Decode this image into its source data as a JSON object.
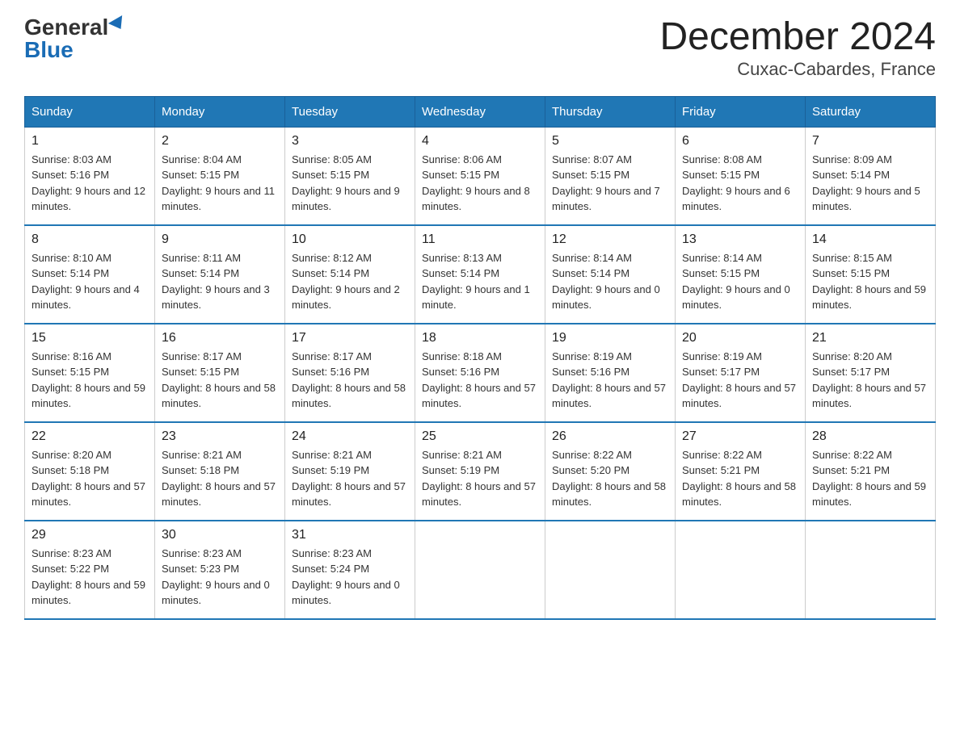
{
  "logo": {
    "general": "General",
    "blue": "Blue"
  },
  "title": "December 2024",
  "subtitle": "Cuxac-Cabardes, France",
  "weekdays": [
    "Sunday",
    "Monday",
    "Tuesday",
    "Wednesday",
    "Thursday",
    "Friday",
    "Saturday"
  ],
  "weeks": [
    [
      {
        "day": "1",
        "sunrise": "8:03 AM",
        "sunset": "5:16 PM",
        "daylight": "9 hours and 12 minutes."
      },
      {
        "day": "2",
        "sunrise": "8:04 AM",
        "sunset": "5:15 PM",
        "daylight": "9 hours and 11 minutes."
      },
      {
        "day": "3",
        "sunrise": "8:05 AM",
        "sunset": "5:15 PM",
        "daylight": "9 hours and 9 minutes."
      },
      {
        "day": "4",
        "sunrise": "8:06 AM",
        "sunset": "5:15 PM",
        "daylight": "9 hours and 8 minutes."
      },
      {
        "day": "5",
        "sunrise": "8:07 AM",
        "sunset": "5:15 PM",
        "daylight": "9 hours and 7 minutes."
      },
      {
        "day": "6",
        "sunrise": "8:08 AM",
        "sunset": "5:15 PM",
        "daylight": "9 hours and 6 minutes."
      },
      {
        "day": "7",
        "sunrise": "8:09 AM",
        "sunset": "5:14 PM",
        "daylight": "9 hours and 5 minutes."
      }
    ],
    [
      {
        "day": "8",
        "sunrise": "8:10 AM",
        "sunset": "5:14 PM",
        "daylight": "9 hours and 4 minutes."
      },
      {
        "day": "9",
        "sunrise": "8:11 AM",
        "sunset": "5:14 PM",
        "daylight": "9 hours and 3 minutes."
      },
      {
        "day": "10",
        "sunrise": "8:12 AM",
        "sunset": "5:14 PM",
        "daylight": "9 hours and 2 minutes."
      },
      {
        "day": "11",
        "sunrise": "8:13 AM",
        "sunset": "5:14 PM",
        "daylight": "9 hours and 1 minute."
      },
      {
        "day": "12",
        "sunrise": "8:14 AM",
        "sunset": "5:14 PM",
        "daylight": "9 hours and 0 minutes."
      },
      {
        "day": "13",
        "sunrise": "8:14 AM",
        "sunset": "5:15 PM",
        "daylight": "9 hours and 0 minutes."
      },
      {
        "day": "14",
        "sunrise": "8:15 AM",
        "sunset": "5:15 PM",
        "daylight": "8 hours and 59 minutes."
      }
    ],
    [
      {
        "day": "15",
        "sunrise": "8:16 AM",
        "sunset": "5:15 PM",
        "daylight": "8 hours and 59 minutes."
      },
      {
        "day": "16",
        "sunrise": "8:17 AM",
        "sunset": "5:15 PM",
        "daylight": "8 hours and 58 minutes."
      },
      {
        "day": "17",
        "sunrise": "8:17 AM",
        "sunset": "5:16 PM",
        "daylight": "8 hours and 58 minutes."
      },
      {
        "day": "18",
        "sunrise": "8:18 AM",
        "sunset": "5:16 PM",
        "daylight": "8 hours and 57 minutes."
      },
      {
        "day": "19",
        "sunrise": "8:19 AM",
        "sunset": "5:16 PM",
        "daylight": "8 hours and 57 minutes."
      },
      {
        "day": "20",
        "sunrise": "8:19 AM",
        "sunset": "5:17 PM",
        "daylight": "8 hours and 57 minutes."
      },
      {
        "day": "21",
        "sunrise": "8:20 AM",
        "sunset": "5:17 PM",
        "daylight": "8 hours and 57 minutes."
      }
    ],
    [
      {
        "day": "22",
        "sunrise": "8:20 AM",
        "sunset": "5:18 PM",
        "daylight": "8 hours and 57 minutes."
      },
      {
        "day": "23",
        "sunrise": "8:21 AM",
        "sunset": "5:18 PM",
        "daylight": "8 hours and 57 minutes."
      },
      {
        "day": "24",
        "sunrise": "8:21 AM",
        "sunset": "5:19 PM",
        "daylight": "8 hours and 57 minutes."
      },
      {
        "day": "25",
        "sunrise": "8:21 AM",
        "sunset": "5:19 PM",
        "daylight": "8 hours and 57 minutes."
      },
      {
        "day": "26",
        "sunrise": "8:22 AM",
        "sunset": "5:20 PM",
        "daylight": "8 hours and 58 minutes."
      },
      {
        "day": "27",
        "sunrise": "8:22 AM",
        "sunset": "5:21 PM",
        "daylight": "8 hours and 58 minutes."
      },
      {
        "day": "28",
        "sunrise": "8:22 AM",
        "sunset": "5:21 PM",
        "daylight": "8 hours and 59 minutes."
      }
    ],
    [
      {
        "day": "29",
        "sunrise": "8:23 AM",
        "sunset": "5:22 PM",
        "daylight": "8 hours and 59 minutes."
      },
      {
        "day": "30",
        "sunrise": "8:23 AM",
        "sunset": "5:23 PM",
        "daylight": "9 hours and 0 minutes."
      },
      {
        "day": "31",
        "sunrise": "8:23 AM",
        "sunset": "5:24 PM",
        "daylight": "9 hours and 0 minutes."
      },
      null,
      null,
      null,
      null
    ]
  ]
}
